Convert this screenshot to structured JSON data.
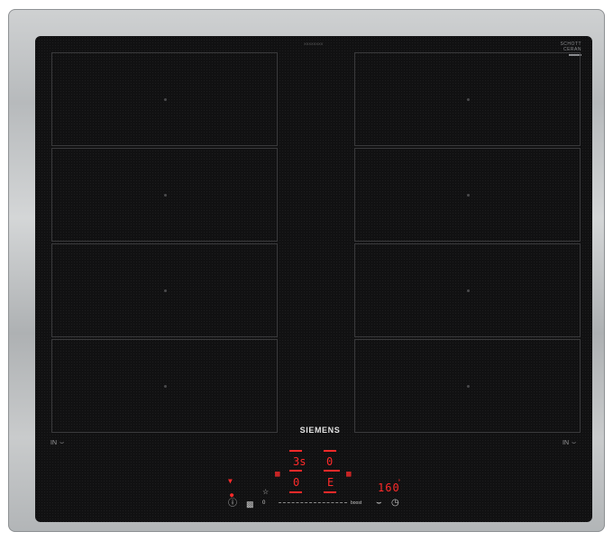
{
  "appliance": {
    "brand": "SIEMENS",
    "glass_badge_line1": "SCHOTT",
    "glass_badge_line2": "CERAN",
    "serial_marking": "XXXXXXXX"
  },
  "zones": {
    "left_label": "IN",
    "right_label": "IN"
  },
  "control_panel": {
    "zone_left_power_level": "3s",
    "zone_right_power_level": "0",
    "zone_left_lower_level": "0",
    "zone_right_lower_level": "E",
    "temperature_display": "160",
    "slider_min_label": "0",
    "slider_max_label": "boost"
  },
  "colors": {
    "frame": "#b7babc",
    "glass": "#111112",
    "display_red": "#ff2a2a"
  },
  "icons": {
    "info": "info-icon",
    "child_lock": "lock-icon",
    "timer": "clock-icon",
    "frying_sensor": "pan-sensor-icon",
    "power_indicator": "power-indicator-icon"
  }
}
